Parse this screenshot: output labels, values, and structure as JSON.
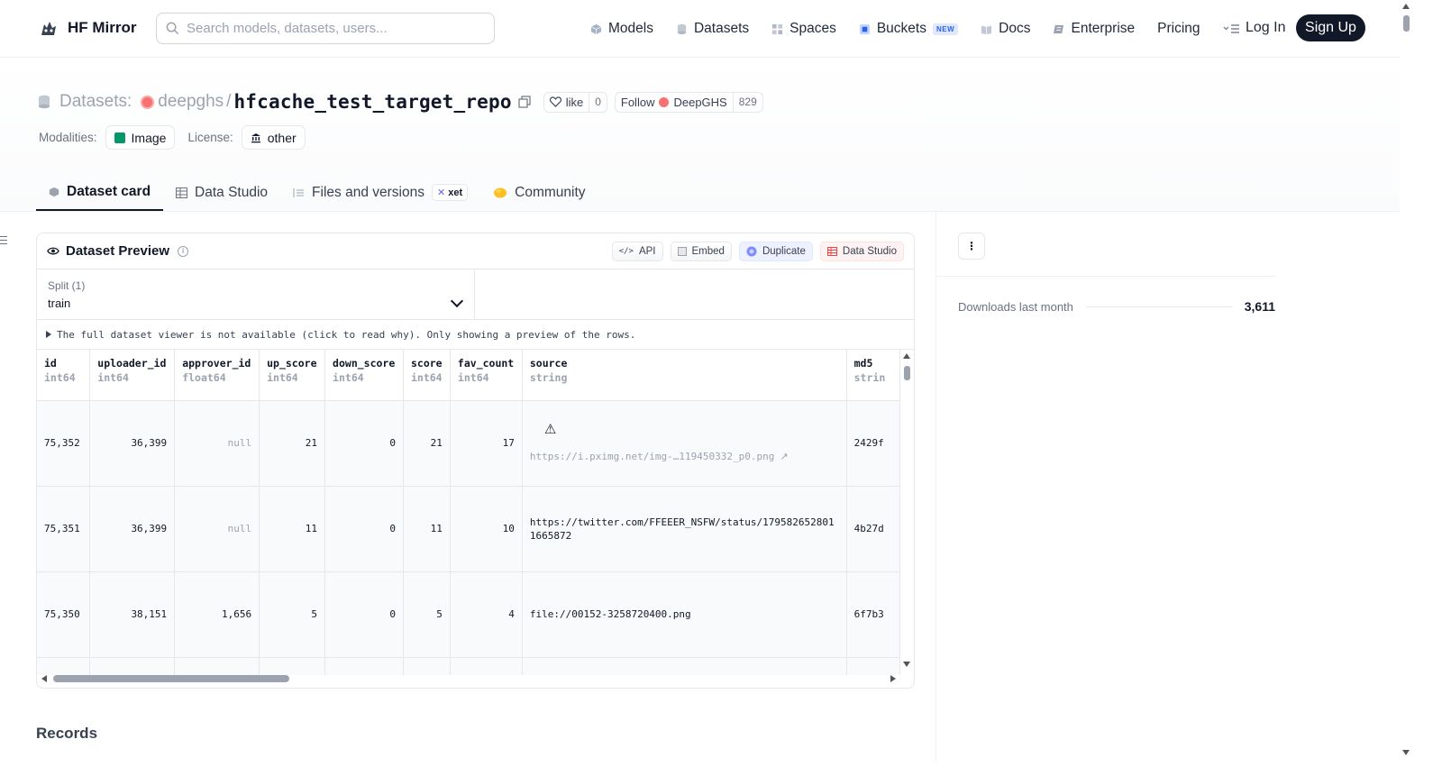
{
  "nav": {
    "brand": "HF Mirror",
    "search_placeholder": "Search models, datasets, users...",
    "links": [
      {
        "label": "Models",
        "icon": "cube-icon"
      },
      {
        "label": "Datasets",
        "icon": "database-icon"
      },
      {
        "label": "Spaces",
        "icon": "grid-icon"
      },
      {
        "label": "Buckets",
        "icon": "bucket-icon",
        "badge": "NEW"
      },
      {
        "label": "Docs",
        "icon": "book-icon"
      },
      {
        "label": "Enterprise",
        "icon": "enterprise-icon"
      },
      {
        "label": "Pricing"
      }
    ],
    "login": "Log In",
    "signup": "Sign Up"
  },
  "repo": {
    "type_label": "Datasets:",
    "org": "deepghs",
    "name": "hfcache_test_target_repo",
    "like_label": "like",
    "like_count": "0",
    "follow_label": "Follow",
    "follow_org": "DeepGHS",
    "follow_count": "829"
  },
  "meta": {
    "modalities_label": "Modalities:",
    "modality": "Image",
    "license_label": "License:",
    "license": "other"
  },
  "tabs": [
    {
      "label": "Dataset card",
      "active": true
    },
    {
      "label": "Data Studio"
    },
    {
      "label": "Files and versions",
      "badge": "xet"
    },
    {
      "label": "Community"
    }
  ],
  "preview": {
    "title": "Dataset Preview",
    "actions": {
      "api": "API",
      "embed": "Embed",
      "duplicate": "Duplicate",
      "data_studio": "Data Studio"
    },
    "split_label": "Split (1)",
    "split_value": "train",
    "notice": "The full dataset viewer is not available (click to read why). Only showing a preview of the rows.",
    "columns": [
      {
        "name": "id",
        "type": "int64"
      },
      {
        "name": "uploader_id",
        "type": "int64"
      },
      {
        "name": "approver_id",
        "type": "float64"
      },
      {
        "name": "up_score",
        "type": "int64"
      },
      {
        "name": "down_score",
        "type": "int64"
      },
      {
        "name": "score",
        "type": "int64"
      },
      {
        "name": "fav_count",
        "type": "int64"
      },
      {
        "name": "source",
        "type": "string"
      },
      {
        "name": "md5",
        "type": "strin"
      }
    ],
    "rows": [
      {
        "id": "75,352",
        "uploader_id": "36,399",
        "approver_id": "null",
        "up_score": "21",
        "down_score": "0",
        "score": "21",
        "fav_count": "17",
        "source": "https://i.pximg.net/img-…119450332_p0.png",
        "md5": "2429f"
      },
      {
        "id": "75,351",
        "uploader_id": "36,399",
        "approver_id": "null",
        "up_score": "11",
        "down_score": "0",
        "score": "11",
        "fav_count": "10",
        "source": "https://twitter.com/FFEEER_NSFW/status/1795826528011665872",
        "md5": "4b27d"
      },
      {
        "id": "75,350",
        "uploader_id": "38,151",
        "approver_id": "1,656",
        "up_score": "5",
        "down_score": "0",
        "score": "5",
        "fav_count": "4",
        "source": "file://00152-3258720400.png",
        "md5": "6f7b3"
      }
    ]
  },
  "records_heading": "Records",
  "sidebar": {
    "kebab": "⋮",
    "downloads_label": "Downloads last month",
    "downloads_value": "3,611"
  }
}
